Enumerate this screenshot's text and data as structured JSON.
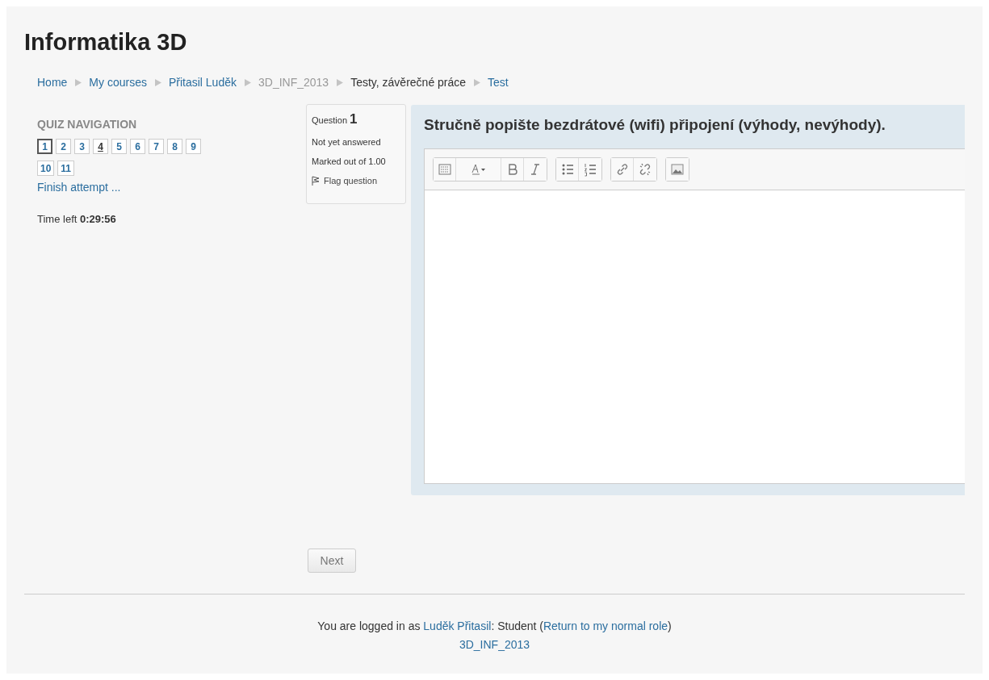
{
  "site_title": "Informatika 3D",
  "breadcrumb": [
    {
      "label": "Home",
      "kind": "link"
    },
    {
      "label": "My courses",
      "kind": "link"
    },
    {
      "label": "Přitasil Luděk",
      "kind": "link"
    },
    {
      "label": "3D_INF_2013",
      "kind": "dimmed"
    },
    {
      "label": "Testy, závěrečné práce",
      "kind": "text"
    },
    {
      "label": "Test",
      "kind": "link"
    }
  ],
  "quiz_navigation": {
    "title": "QUIZ NAVIGATION",
    "questions": [
      {
        "label": "1",
        "selected": true,
        "hovered": false
      },
      {
        "label": "2",
        "selected": false,
        "hovered": false
      },
      {
        "label": "3",
        "selected": false,
        "hovered": false
      },
      {
        "label": "4",
        "selected": false,
        "hovered": true
      },
      {
        "label": "5",
        "selected": false,
        "hovered": false
      },
      {
        "label": "6",
        "selected": false,
        "hovered": false
      },
      {
        "label": "7",
        "selected": false,
        "hovered": false
      },
      {
        "label": "8",
        "selected": false,
        "hovered": false
      },
      {
        "label": "9",
        "selected": false,
        "hovered": false
      },
      {
        "label": "10",
        "selected": false,
        "hovered": false
      },
      {
        "label": "11",
        "selected": false,
        "hovered": false
      }
    ],
    "finish_link": "Finish attempt ...",
    "time_label": "Time left",
    "time_value": "0:29:56"
  },
  "question_info": {
    "label": "Question",
    "number": "1",
    "status": "Not yet answered",
    "marks": "Marked out of 1.00",
    "flag": "Flag question"
  },
  "question_text": "Stručně popište bezdrátové (wifi) připojení (výhody, nevýhody).",
  "toolbar_groups": [
    {
      "buttons": [
        {
          "kind": "toggle"
        },
        {
          "kind": "fontstyle"
        },
        {
          "kind": "bold"
        },
        {
          "kind": "italic"
        }
      ]
    },
    {
      "buttons": [
        {
          "kind": "bullets"
        },
        {
          "kind": "numbers"
        }
      ]
    },
    {
      "buttons": [
        {
          "kind": "link"
        },
        {
          "kind": "unlink"
        }
      ]
    },
    {
      "buttons": [
        {
          "kind": "image"
        }
      ]
    }
  ],
  "next_button": "Next",
  "footer": {
    "segments": [
      {
        "text": "You are logged in as ",
        "kind": "text"
      },
      {
        "text": "Luděk Přitasil",
        "kind": "link"
      },
      {
        "text": ": Student (",
        "kind": "text"
      },
      {
        "text": "Return to my normal role",
        "kind": "link"
      },
      {
        "text": ")",
        "kind": "text"
      }
    ],
    "course_link": "3D_INF_2013"
  }
}
